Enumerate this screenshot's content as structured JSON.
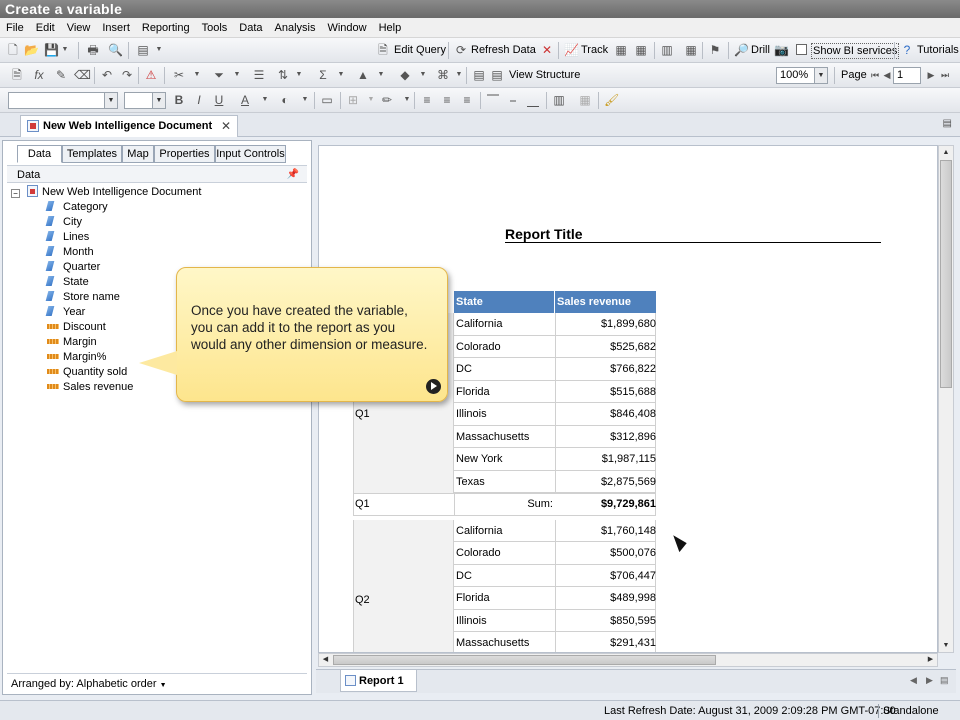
{
  "window": {
    "title": "Create a variable"
  },
  "menu": [
    "File",
    "Edit",
    "View",
    "Insert",
    "Reporting",
    "Tools",
    "Data",
    "Analysis",
    "Window",
    "Help"
  ],
  "toolbar1": {
    "edit_query": "Edit Query",
    "refresh_data": "Refresh Data",
    "track": "Track",
    "drill": "Drill",
    "show_bi_services": "Show BI services",
    "tutorials": "Tutorials"
  },
  "toolbar2": {
    "view_structure": "View Structure",
    "zoom": "100%",
    "page_label": "Page",
    "page_value": "1"
  },
  "doc_tab": {
    "label": "New Web Intelligence Document"
  },
  "left_panel": {
    "tabs": [
      "Data",
      "Templates",
      "Map",
      "Properties",
      "Input Controls"
    ],
    "header": "Data",
    "tree_root": "New Web Intelligence Document",
    "dimensions": [
      "Category",
      "City",
      "Lines",
      "Month",
      "Quarter",
      "State",
      "Store name",
      "Year"
    ],
    "measures": [
      "Discount",
      "Margin",
      "Margin%",
      "Quantity sold",
      "Sales revenue"
    ],
    "arranged_by": "Arranged by: Alphabetic order"
  },
  "report": {
    "title": "Report Title",
    "columns": [
      "State",
      "Sales revenue"
    ],
    "q1_label": "Q1",
    "q1_rows": [
      [
        "California",
        "$1,899,680"
      ],
      [
        "Colorado",
        "$525,682"
      ],
      [
        "DC",
        "$766,822"
      ],
      [
        "Florida",
        "$515,688"
      ],
      [
        "Illinois",
        "$846,408"
      ],
      [
        "Massachusetts",
        "$312,896"
      ],
      [
        "New York",
        "$1,987,115"
      ],
      [
        "Texas",
        "$2,875,569"
      ]
    ],
    "q1_sum_label": "Q1",
    "sum_text": "Sum:",
    "q1_sum_value": "$9,729,861",
    "q2_label": "Q2",
    "q2_rows": [
      [
        "California",
        "$1,760,148"
      ],
      [
        "Colorado",
        "$500,076"
      ],
      [
        "DC",
        "$706,447"
      ],
      [
        "Florida",
        "$489,998"
      ],
      [
        "Illinois",
        "$850,595"
      ],
      [
        "Massachusetts",
        "$291,431"
      ]
    ]
  },
  "tooltip": {
    "text": "Once you have created the variable, you can add it to the report as you would any other dimension or measure."
  },
  "report_tab": {
    "label": "Report 1"
  },
  "status": {
    "refresh": "Last Refresh Date: August 31, 2009 2:09:28 PM GMT-07:00",
    "mode": "Standalone"
  }
}
